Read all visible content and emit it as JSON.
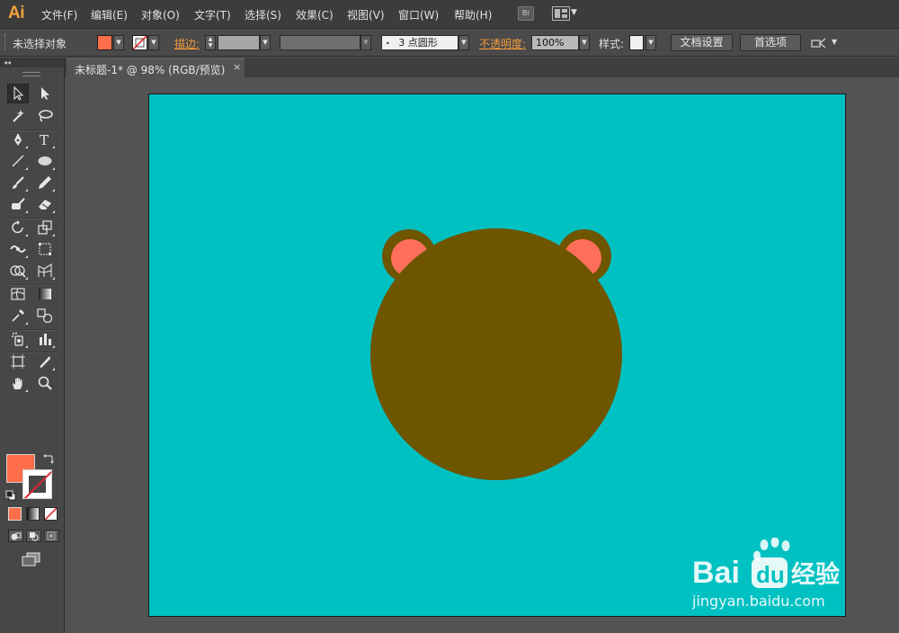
{
  "app": {
    "logo": "Ai",
    "menus": [
      "文件(F)",
      "编辑(E)",
      "对象(O)",
      "文字(T)",
      "选择(S)",
      "效果(C)",
      "视图(V)",
      "窗口(W)",
      "帮助(H)"
    ],
    "bridge_label": "Br"
  },
  "control_bar": {
    "selection_status": "未选择对象",
    "fill_color": "#ff6e4a",
    "stroke_label": "描边:",
    "brush_value": "3 点圆形",
    "opacity_label": "不透明度:",
    "opacity_value": "100%",
    "style_label": "样式:",
    "document_setup": "文档设置",
    "preferences": "首选项"
  },
  "document": {
    "tab_title": "未标题-1* @ 98% (RGB/预览)",
    "close_glyph": "×"
  },
  "artwork": {
    "background_color": "#00c1c2",
    "face_color": "#6e5500",
    "inner_ear_color": "#ff6e5a"
  },
  "colors": {
    "fill": "#ff6e4a",
    "stroke": "none"
  },
  "watermark": {
    "brand": "Bai",
    "brand_suffix": "经验",
    "url": "jingyan.baidu.com"
  }
}
